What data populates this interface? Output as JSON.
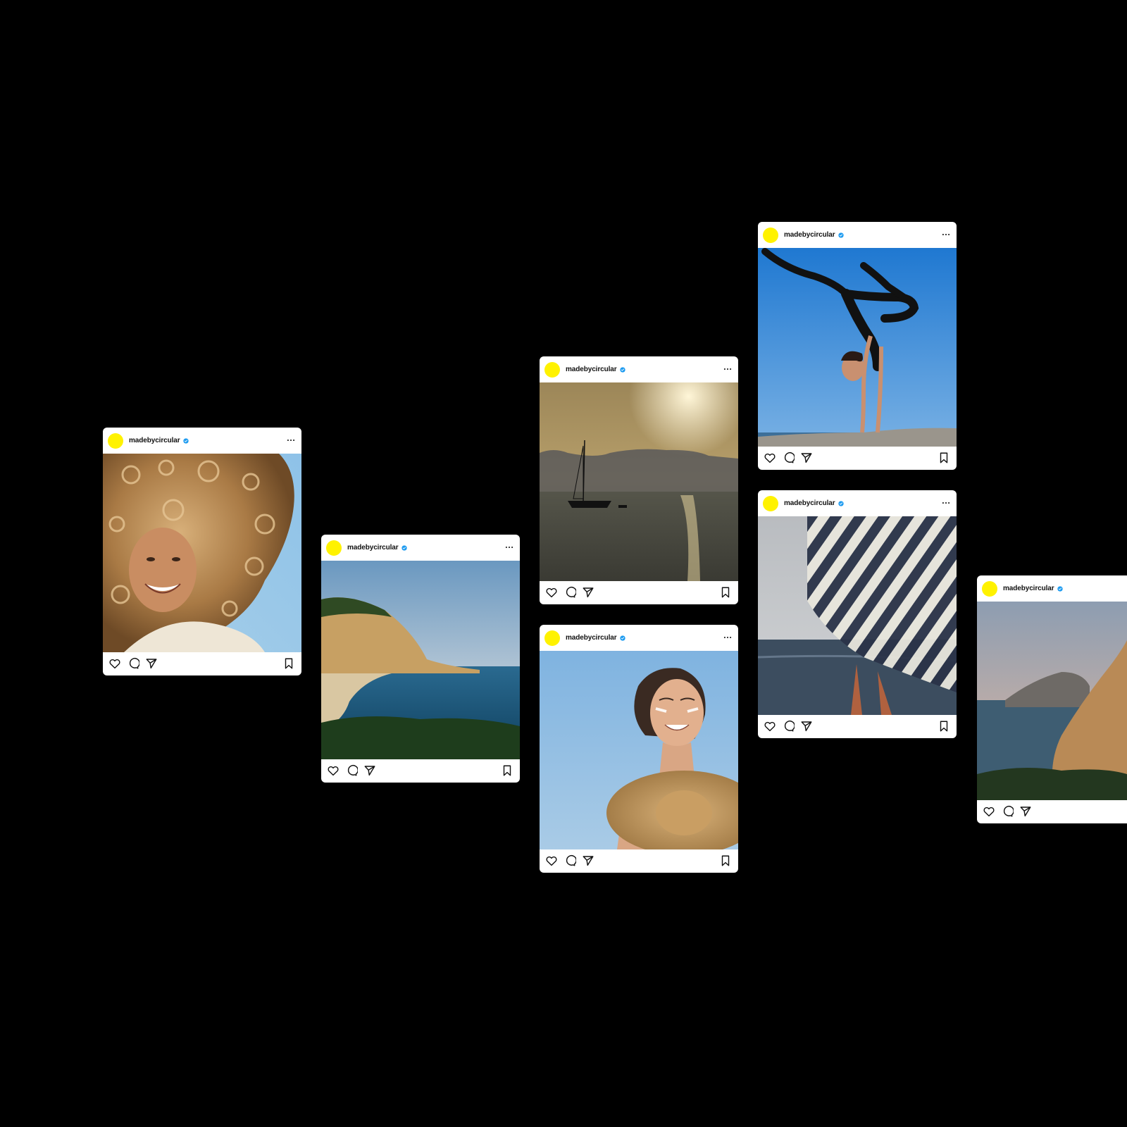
{
  "posts": [
    {
      "username": "madebycircular",
      "verified": true,
      "photo": "curly-haired-woman-smiling"
    },
    {
      "username": "madebycircular",
      "verified": true,
      "photo": "coastal-cliff-beach"
    },
    {
      "username": "madebycircular",
      "verified": true,
      "photo": "sailboat-at-sunset"
    },
    {
      "username": "madebycircular",
      "verified": true,
      "photo": "woman-with-straw-hat"
    },
    {
      "username": "madebycircular",
      "verified": true,
      "photo": "yoga-handstand-by-sea"
    },
    {
      "username": "madebycircular",
      "verified": true,
      "photo": "striped-beach-umbrella"
    },
    {
      "username": "madebycircular",
      "verified": true,
      "photo": "cliff-coastline-evening"
    }
  ],
  "colors": {
    "background": "#000000",
    "avatar": "#fff200",
    "verified_badge": "#1d9bf0"
  },
  "icons": [
    "like-icon",
    "comment-icon",
    "share-icon",
    "bookmark-icon",
    "more-options-icon",
    "verified-badge-icon"
  ]
}
